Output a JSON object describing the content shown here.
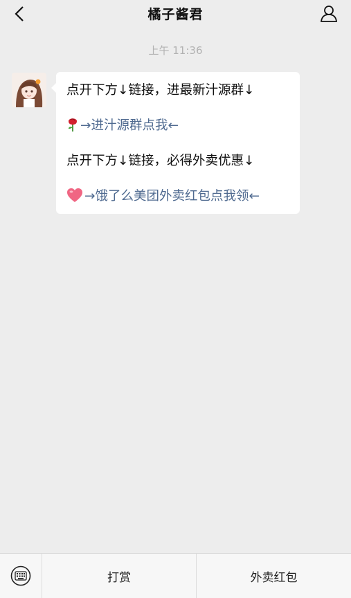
{
  "header": {
    "title": "橘子酱君",
    "back_icon": "chevron-left-icon",
    "profile_icon": "user-icon"
  },
  "chat": {
    "time": "上午 11:36",
    "message": {
      "line1": "点开下方↓链接，进最新汁源群↓",
      "line2_emoji": "rose-icon",
      "line2_link": "→进汁源群点我←",
      "line3": "点开下方↓链接，必得外卖优惠↓",
      "line4_emoji": "heart-icon",
      "line4_link": "→饿了么美团外卖红包点我领←"
    }
  },
  "bottom_menu": {
    "keyboard_icon": "keyboard-icon",
    "items": [
      {
        "label": "打赏"
      },
      {
        "label": "外卖红包"
      }
    ]
  },
  "colors": {
    "background": "#ededed",
    "link": "#4f6a90",
    "bubble": "#ffffff"
  }
}
